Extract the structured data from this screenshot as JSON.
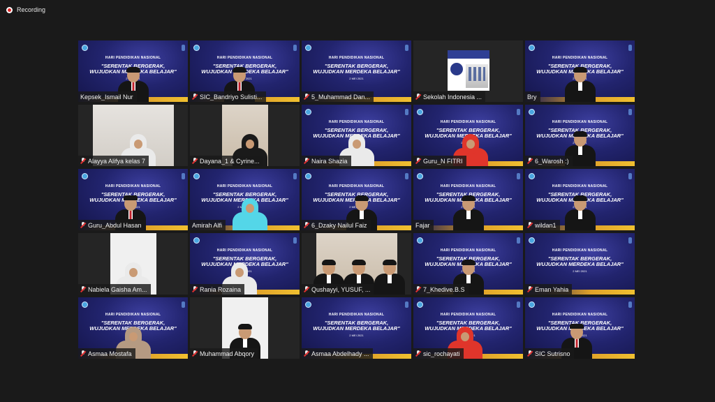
{
  "recording": {
    "label": "Recording"
  },
  "banner": {
    "line1": "HARI PENDIDIKAN NASIONAL",
    "line2": "\"SERENTAK BERGERAK,",
    "line3": "WUJUDKAN MERDEKA BELAJAR\"",
    "date": "2 MEI 2021"
  },
  "participants": [
    {
      "name": "Kepsek_Ismail Nur",
      "muted": false,
      "bg": "banner",
      "person": "suit-redtie",
      "x": 0.5
    },
    {
      "name": "SIC_Bandriyo Sulisti...",
      "muted": true,
      "bg": "banner",
      "person": "suit-redtie",
      "x": 0.45
    },
    {
      "name": "5_Muhammad Dan...",
      "muted": true,
      "bg": "banner",
      "person": "none"
    },
    {
      "name": "Sekolah Indonesia ...",
      "muted": true,
      "bg": "school",
      "person": "none"
    },
    {
      "name": "Bry",
      "muted": false,
      "bg": "banner",
      "person": "suit",
      "x": 0.5
    },
    {
      "name": "Alayya Alifya kelas 7",
      "muted": true,
      "bg": "wall",
      "person": "hijab",
      "x": 0.55
    },
    {
      "name": "Dayana_1 & Cyrine...",
      "muted": true,
      "bg": "warm",
      "person": "hijab-black",
      "x": 0.55
    },
    {
      "name": "Naira Shazia",
      "muted": true,
      "bg": "banner",
      "person": "hijab",
      "x": 0.5
    },
    {
      "name": "Guru_N FITRI",
      "muted": true,
      "bg": "banner",
      "person": "hijab-red",
      "x": 0.52
    },
    {
      "name": "6_Warosh :)",
      "muted": true,
      "bg": "banner",
      "person": "suit",
      "x": 0.5
    },
    {
      "name": "Guru_Abdul Hasan",
      "muted": true,
      "bg": "banner",
      "person": "suit-redtie-peci",
      "x": 0.48
    },
    {
      "name": "Amirah Alfi",
      "muted": false,
      "bg": "banner",
      "person": "hijab-cyan",
      "x": 0.55,
      "speaking": true
    },
    {
      "name": "6_Dzaky Nailul Faiz",
      "muted": true,
      "bg": "banner",
      "person": "suit",
      "x": 0.55
    },
    {
      "name": "Fajar",
      "muted": false,
      "bg": "banner",
      "person": "suit",
      "x": 0.5
    },
    {
      "name": "wildan1",
      "muted": true,
      "bg": "banner",
      "person": "suit",
      "x": 0.5
    },
    {
      "name": "Nabiela Gaisha Am...",
      "muted": true,
      "bg": "white",
      "person": "hijab",
      "x": 0.5
    },
    {
      "name": "Rania Rozaina",
      "muted": true,
      "bg": "banner",
      "person": "hijab",
      "x": 0.45
    },
    {
      "name": "Qushayyi, YUSUF, ...",
      "muted": true,
      "bg": "warm-full",
      "person": "three-boys"
    },
    {
      "name": "7_Khedive.B.S",
      "muted": true,
      "bg": "banner",
      "person": "suit",
      "x": 0.5
    },
    {
      "name": "Eman Yahia",
      "muted": true,
      "bg": "banner",
      "person": "none"
    },
    {
      "name": "Asmaa Mostafa",
      "muted": true,
      "bg": "banner",
      "person": "hijab-beige",
      "x": 0.5
    },
    {
      "name": "Muhammad Abqory",
      "muted": true,
      "bg": "white-small",
      "person": "suit",
      "x": 0.5
    },
    {
      "name": "Asmaa Abdelhady ...",
      "muted": true,
      "bg": "banner",
      "person": "none"
    },
    {
      "name": "sic_rochayati",
      "muted": true,
      "bg": "banner",
      "person": "hijab-red",
      "x": 0.47
    },
    {
      "name": "SIC Sutrisno",
      "muted": true,
      "bg": "banner",
      "person": "suit-redtie-peci",
      "x": 0.47
    }
  ]
}
